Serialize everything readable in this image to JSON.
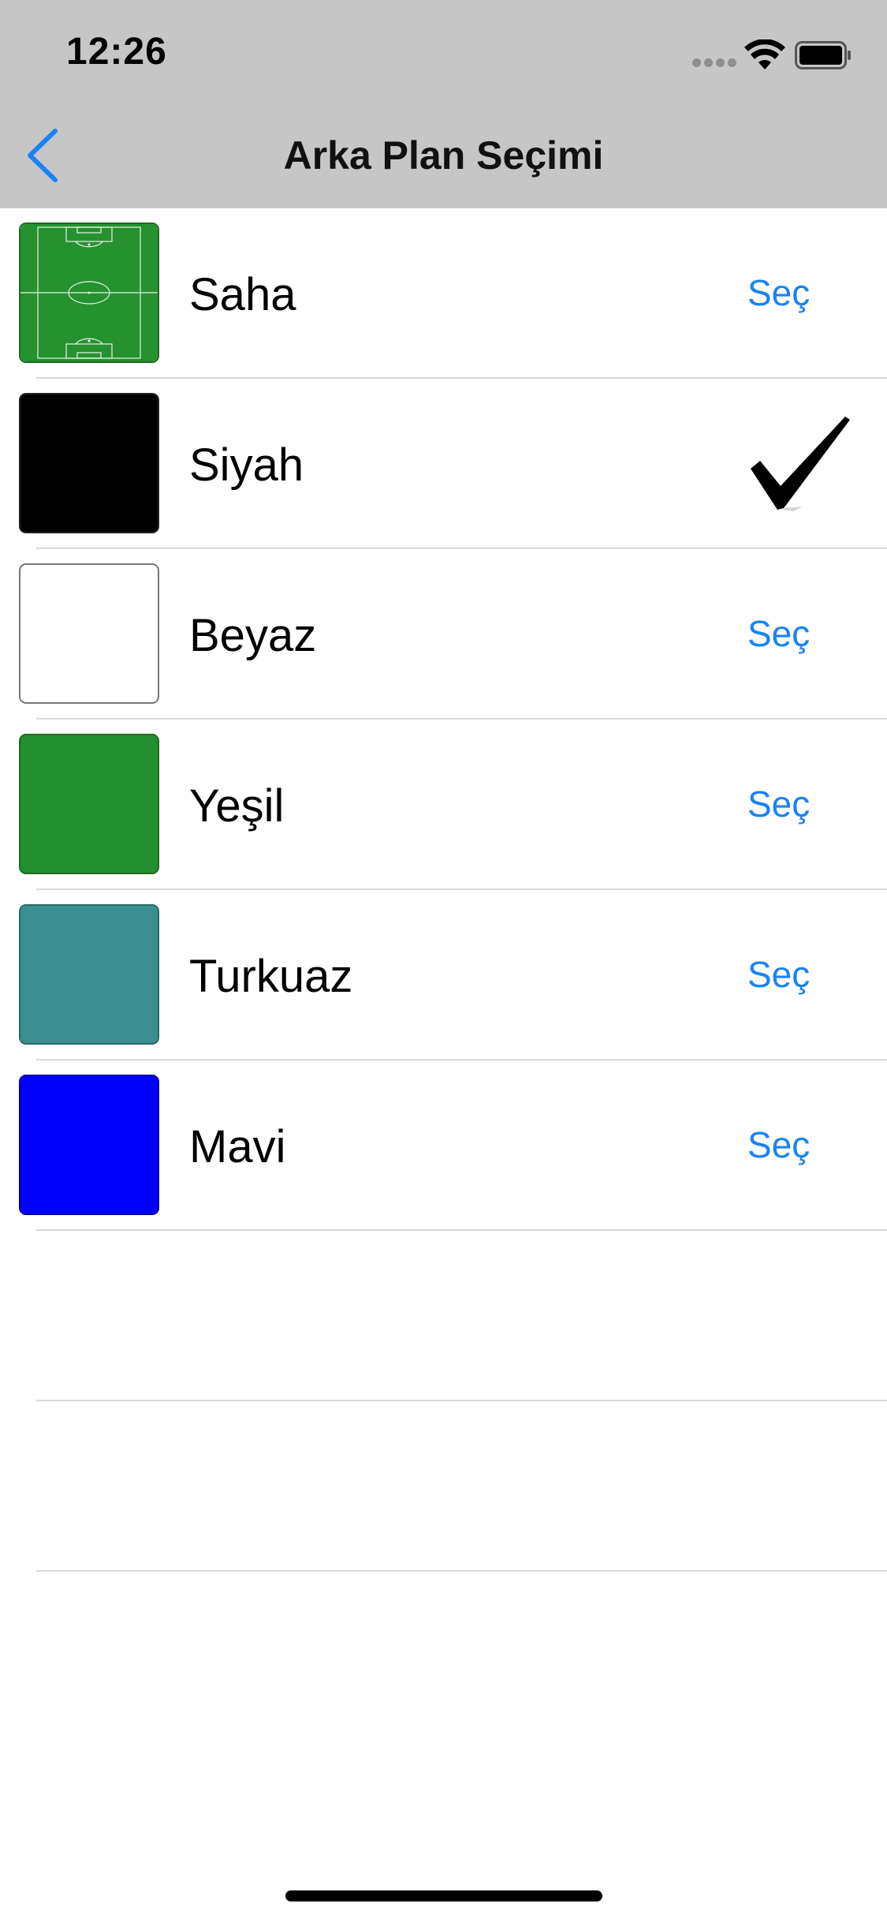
{
  "status_bar": {
    "time": "12:26"
  },
  "nav": {
    "back_icon": "chevron-left-icon",
    "title": "Arka Plan Seçimi"
  },
  "accent_color": "#1a82f7",
  "options": [
    {
      "label": "Saha",
      "swatch": "football-pitch",
      "color": "#26912f",
      "selected": false,
      "action": "Seç"
    },
    {
      "label": "Siyah",
      "swatch": "solid",
      "color": "#000000",
      "selected": true,
      "action": ""
    },
    {
      "label": "Beyaz",
      "swatch": "solid",
      "color": "#ffffff",
      "selected": false,
      "action": "Seç"
    },
    {
      "label": "Yeşil",
      "swatch": "solid",
      "color": "#248f2f",
      "selected": false,
      "action": "Seç"
    },
    {
      "label": "Turkuaz",
      "swatch": "solid",
      "color": "#3b8e8f",
      "selected": false,
      "action": "Seç"
    },
    {
      "label": "Mavi",
      "swatch": "solid",
      "color": "#0000ff",
      "selected": false,
      "action": "Seç"
    }
  ]
}
